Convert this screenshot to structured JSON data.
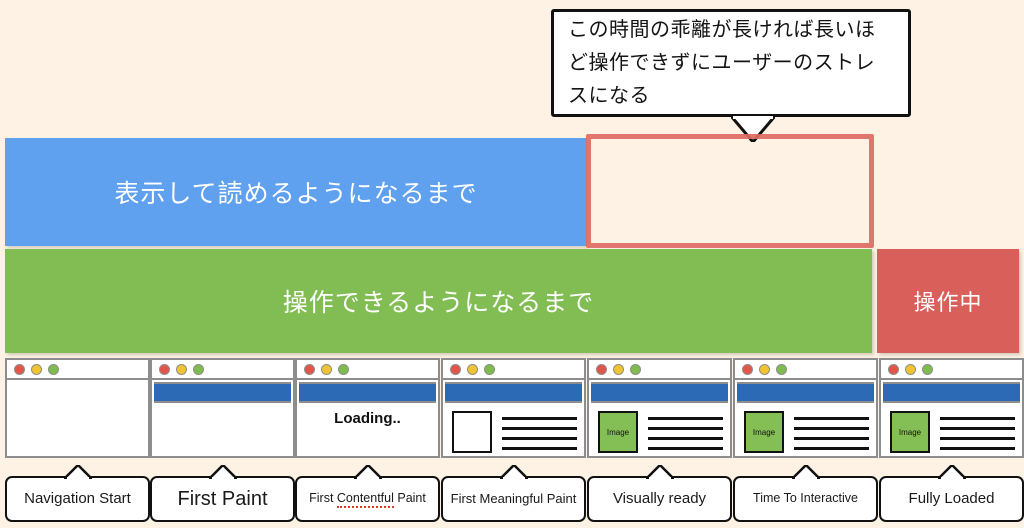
{
  "page": {
    "background_color": "#fdf2e3"
  },
  "callout": {
    "text": "この時間の乖離が長ければ長いほど操作できずにユーザーのストレスになる",
    "border_color": "#111111",
    "background_color": "#ffffff"
  },
  "bars": {
    "display": {
      "label": "表示して読めるようになるまで",
      "color": "#5fa0ef"
    },
    "interactive": {
      "label": "操作できるようになるまで",
      "color": "#81bd52"
    },
    "operating": {
      "label": "操作中",
      "color": "#d9605a"
    }
  },
  "highlight": {
    "color": "#dd6b63"
  },
  "thumbnails": [
    {
      "name": "navigation-start",
      "window_dots": [
        "red",
        "yellow",
        "green"
      ],
      "has_nav_strip": false,
      "loading_text": "",
      "has_content": false,
      "image_label": "",
      "image_filled": false,
      "line_count": 0
    },
    {
      "name": "first-paint",
      "window_dots": [
        "red",
        "yellow",
        "green"
      ],
      "has_nav_strip": true,
      "loading_text": "",
      "has_content": false,
      "image_label": "",
      "image_filled": false,
      "line_count": 0
    },
    {
      "name": "first-contentful-paint",
      "window_dots": [
        "red",
        "yellow",
        "green"
      ],
      "has_nav_strip": true,
      "loading_text": "Loading..",
      "has_content": false,
      "image_label": "",
      "image_filled": false,
      "line_count": 0
    },
    {
      "name": "first-meaningful-paint",
      "window_dots": [
        "red",
        "yellow",
        "green"
      ],
      "has_nav_strip": true,
      "loading_text": "",
      "has_content": true,
      "image_label": "",
      "image_filled": false,
      "line_count": 4
    },
    {
      "name": "visually-ready",
      "window_dots": [
        "red",
        "yellow",
        "green"
      ],
      "has_nav_strip": true,
      "loading_text": "",
      "has_content": true,
      "image_label": "Image",
      "image_filled": true,
      "line_count": 4
    },
    {
      "name": "time-to-interactive",
      "window_dots": [
        "red",
        "yellow",
        "green"
      ],
      "has_nav_strip": true,
      "loading_text": "",
      "has_content": true,
      "image_label": "Image",
      "image_filled": true,
      "line_count": 4
    },
    {
      "name": "fully-loaded",
      "window_dots": [
        "red",
        "yellow",
        "green"
      ],
      "has_nav_strip": true,
      "loading_text": "",
      "has_content": true,
      "image_label": "Image",
      "image_filled": true,
      "line_count": 4
    }
  ],
  "milestones": [
    {
      "name": "navigation-start",
      "label": "Navigation Start",
      "size": "med",
      "misspelled_word": ""
    },
    {
      "name": "first-paint",
      "label": "First Paint",
      "size": "large",
      "misspelled_word": ""
    },
    {
      "name": "first-contentful-paint",
      "label_prefix": "First ",
      "label": "First Contentful Paint",
      "size": "tiny",
      "misspelled_word": "Contentful",
      "label_suffix": "Paint"
    },
    {
      "name": "first-meaningful-paint",
      "label": "First Meaningful Paint",
      "size": "small",
      "misspelled_word": ""
    },
    {
      "name": "visually-ready",
      "label": "Visually ready",
      "size": "med",
      "misspelled_word": ""
    },
    {
      "name": "time-to-interactive",
      "label": "Time To Interactive",
      "size": "tiny",
      "misspelled_word": ""
    },
    {
      "name": "fully-loaded",
      "label": "Fully Loaded",
      "size": "med",
      "misspelled_word": ""
    }
  ]
}
